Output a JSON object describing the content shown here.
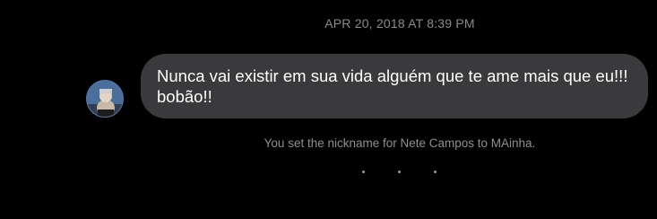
{
  "conversation": {
    "timestamp": "APR 20, 2018 AT 8:39 PM",
    "messages": [
      {
        "sender_avatar": "contact-avatar",
        "text": "Nunca vai existir em sua vida alguém que te ame mais que eu!!! bobão!!"
      }
    ],
    "system_note": "You set the nickname for Nete Campos to MAinha."
  },
  "colors": {
    "background": "#000000",
    "bubble": "#3a3a3c",
    "message_text": "#ffffff",
    "meta_text": "#8a8a8a"
  },
  "icons": {
    "avatar": "profile-photo",
    "typing_indicator": "dots-icon"
  }
}
